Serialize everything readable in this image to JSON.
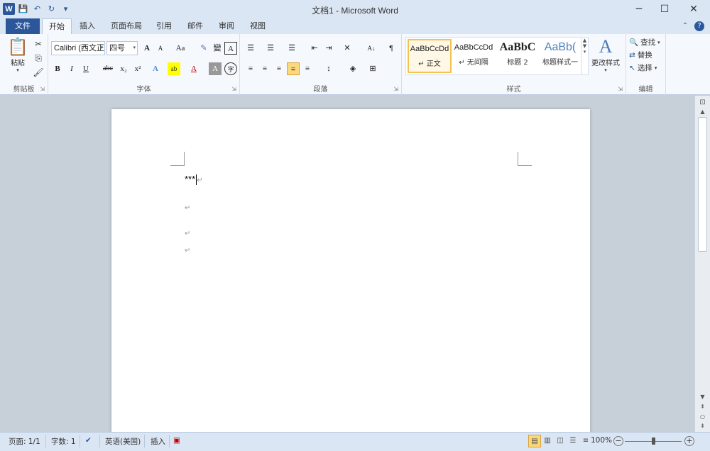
{
  "window": {
    "title": "文档1 - Microsoft Word",
    "app_logo": "W",
    "minimize": "─",
    "maximize": "☐",
    "close": "✕"
  },
  "qat": {
    "save": "💾",
    "undo": "↶",
    "redo": "↻",
    "customize": "▾"
  },
  "tabs": {
    "file": "文件",
    "home": "开始",
    "insert": "插入",
    "layout": "页面布局",
    "references": "引用",
    "mailings": "邮件",
    "review": "审阅",
    "view": "视图",
    "collapse": "⌃",
    "help": "?"
  },
  "ribbon": {
    "clipboard": {
      "label": "剪贴板",
      "paste": "粘贴",
      "paste_icon": "📋",
      "cut": "✂",
      "copy": "⎘",
      "format_painter": "🖌"
    },
    "font": {
      "label": "字体",
      "font_name": "Calibri (西文正",
      "font_size": "四号",
      "grow": "A",
      "shrink": "A",
      "case": "Aa",
      "clear": "✎",
      "phonetic": "變",
      "border_char": "A",
      "bold": "B",
      "italic": "I",
      "underline": "U",
      "strike": "abc",
      "subscript": "x₂",
      "superscript": "x²",
      "text_effect": "A",
      "highlight": "ab",
      "font_color": "A",
      "char_shading": "A",
      "enclose": "字"
    },
    "paragraph": {
      "label": "段落",
      "bullets": "☰",
      "numbering": "☰",
      "multilevel": "☰",
      "decrease_indent": "⇤",
      "increase_indent": "⇥",
      "chinese_layout": "✕",
      "sort": "A↓",
      "show_marks": "¶",
      "align_left": "≡",
      "center": "≡",
      "align_right": "≡",
      "justify": "≡",
      "distributed": "≡",
      "line_spacing": "↕",
      "shading": "◈",
      "borders": "⊞"
    },
    "styles": {
      "label": "样式",
      "items": [
        {
          "preview": "AaBbCcDd",
          "name": "↵ 正文"
        },
        {
          "preview": "AaBbCcDd",
          "name": "↵ 无间隔"
        },
        {
          "preview": "AaBbC",
          "name": "标题 2"
        },
        {
          "preview": "AaBb(",
          "name": "标题样式一"
        }
      ],
      "change_styles": "更改样式",
      "change_styles_icon": "A"
    },
    "editing": {
      "label": "编辑",
      "find": "查找",
      "replace": "替换",
      "select": "选择"
    }
  },
  "document": {
    "line1": "***",
    "para_mark": "↵"
  },
  "status": {
    "page": "页面: 1/1",
    "words": "字数: 1",
    "language": "英语(美国)",
    "mode": "插入",
    "zoom": "100%",
    "zoom_minus": "−",
    "zoom_plus": "+"
  },
  "colors": {
    "accent": "#2b579a",
    "highlight": "#fbd87b",
    "font_color_red": "#c00000",
    "highlight_yellow": "#ffff00"
  }
}
